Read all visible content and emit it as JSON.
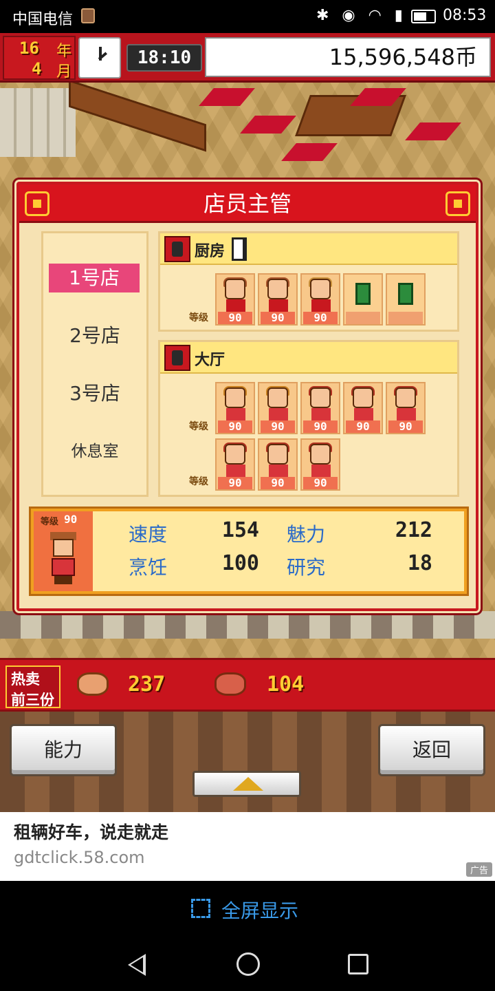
{
  "status_bar": {
    "carrier": "中国电信",
    "time": "08:53",
    "icons": [
      "bluetooth-icon",
      "eye-icon",
      "wifi-icon",
      "4g-signal-icon",
      "battery-icon"
    ]
  },
  "hud": {
    "year_num": "16",
    "year_unit": "年",
    "month_num": "4",
    "month_unit": "月",
    "game_time": "18:10",
    "money": "15,596,548币"
  },
  "dialog": {
    "title": "店员主管",
    "stores": [
      {
        "label": "1号店",
        "active": true
      },
      {
        "label": "2号店",
        "active": false
      },
      {
        "label": "3号店",
        "active": false
      },
      {
        "label": "休息室",
        "active": false
      }
    ],
    "kitchen": {
      "title": "厨房",
      "level_tag": "等级",
      "staff_levels": [
        "90",
        "90",
        "90"
      ],
      "empty_slots": 2
    },
    "hall": {
      "title": "大厅",
      "level_tag": "等级",
      "row1_levels": [
        "90",
        "90",
        "90",
        "90",
        "90"
      ],
      "row2_levels": [
        "90",
        "90",
        "90"
      ]
    },
    "selected": {
      "level_label": "等级",
      "level": "90",
      "stats": [
        {
          "label": "速度",
          "value": "154"
        },
        {
          "label": "魅力",
          "value": "212"
        },
        {
          "label": "烹饪",
          "value": "100"
        },
        {
          "label": "研究",
          "value": "18"
        }
      ]
    }
  },
  "bestseller": {
    "label_line1": "热卖",
    "label_line2": "前三份",
    "items": [
      {
        "icon": "dish-platter-icon",
        "count": "237"
      },
      {
        "icon": "dish-basket-icon",
        "count": "104"
      }
    ]
  },
  "menu": {
    "ability_label": "能力",
    "back_label": "返回"
  },
  "ad": {
    "title": "租辆好车，说走就走",
    "url": "gdtclick.58.com",
    "badge": "广告"
  },
  "fullscreen": {
    "label": "全屏显示"
  },
  "colors": {
    "brand_red": "#c8141d",
    "panel_cream": "#f6e2b3",
    "active_pink": "#e8467a",
    "stat_blue": "#2a6ac8",
    "gold": "#ffcc33"
  }
}
